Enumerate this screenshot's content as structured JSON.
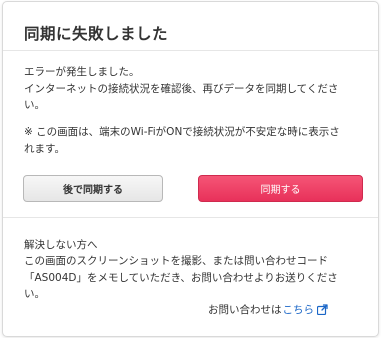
{
  "dialog": {
    "title": "同期に失敗しました",
    "message_line1": "エラーが発生しました。",
    "message_line2": "インターネットの接続状況を確認後、再びデータを同期してくださ",
    "message_line3": "い。",
    "note_line1": "※ この画面は、端末のWi-FiがONで接続状況が不安定な時に表示さ",
    "note_line2": "れます。",
    "buttons": {
      "later_label": "後で同期する",
      "sync_label": "同期する"
    },
    "help": {
      "title": "解決しない方へ",
      "line1": "この画面のスクリーンショットを撮影、または問い合わせコード",
      "line2": "「AS004D」をメモしていただき、お問い合わせよりお送りくださ",
      "line3": "い。",
      "contact_prefix": "お問い合わせは",
      "contact_link": "こちら",
      "contact_icon": "external-link-icon"
    },
    "colors": {
      "primary": "#ee3e64",
      "link": "#1a66c7"
    }
  }
}
